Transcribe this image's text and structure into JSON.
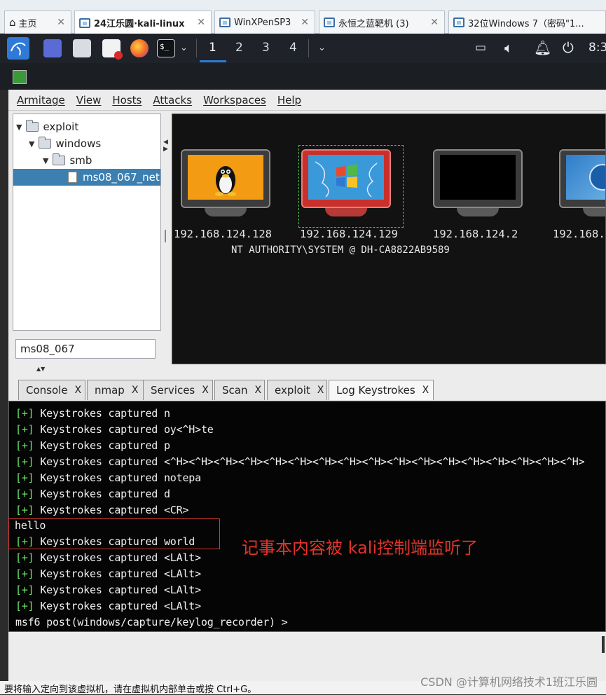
{
  "vm_tabs": [
    {
      "label": "主页",
      "active": false
    },
    {
      "label": "24江乐圆·kali-linux",
      "active": true
    },
    {
      "label": "WinXPenSP3",
      "active": false
    },
    {
      "label": "永恒之蓝靶机 (3)",
      "active": false
    },
    {
      "label": "32位Windows 7（密码\"1...",
      "active": false
    }
  ],
  "taskbar": {
    "workspaces": [
      "1",
      "2",
      "3",
      "4"
    ],
    "active_workspace": "1",
    "clock": "8:3"
  },
  "menu": [
    "Armitage",
    "View",
    "Hosts",
    "Attacks",
    "Workspaces",
    "Help"
  ],
  "tree": {
    "items": [
      {
        "label": "exploit"
      },
      {
        "label": "windows"
      },
      {
        "label": "smb"
      },
      {
        "label": "ms08_067_net"
      }
    ]
  },
  "search": {
    "value": "ms08_067"
  },
  "hosts": [
    {
      "ip": "192.168.124.128",
      "os": "linux"
    },
    {
      "ip": "192.168.124.129",
      "os": "windows-xp",
      "compromised": true,
      "user": "NT AUTHORITY\\SYSTEM @ DH-CA8822AB9589"
    },
    {
      "ip": "192.168.124.2",
      "os": "unknown"
    },
    {
      "ip": "192.168.",
      "os": "windows-7"
    }
  ],
  "console_tabs": [
    {
      "label": "Console",
      "close": "X"
    },
    {
      "label": "nmap",
      "close": "X"
    },
    {
      "label": "Services",
      "close": "X"
    },
    {
      "label": "Scan",
      "close": "X"
    },
    {
      "label": "exploit",
      "close": "X"
    },
    {
      "label": "Log Keystrokes",
      "close": "X",
      "active": true
    }
  ],
  "console_lines": [
    {
      "prefix": "[+]",
      "text": "Keystrokes captured n"
    },
    {
      "prefix": "[+]",
      "text": "Keystrokes captured oy<^H>te"
    },
    {
      "prefix": "[+]",
      "text": "Keystrokes captured p"
    },
    {
      "prefix": "[+]",
      "text": "Keystrokes captured <^H><^H><^H><^H><^H><^H><^H><^H><^H><^H><^H><^H><^H><^H><^H><^H><^H>"
    },
    {
      "prefix": "[+]",
      "text": "Keystrokes captured notepa"
    },
    {
      "prefix": "[+]",
      "text": "Keystrokes captured d"
    },
    {
      "prefix": "[+]",
      "text": "Keystrokes captured <CR>"
    },
    {
      "prefix": "",
      "text": "hello"
    },
    {
      "prefix": "[+]",
      "text": "Keystrokes captured world"
    },
    {
      "prefix": "[+]",
      "text": "Keystrokes captured <LAlt>"
    },
    {
      "prefix": "[+]",
      "text": "Keystrokes captured <LAlt>"
    },
    {
      "prefix": "[+]",
      "text": "Keystrokes captured <LAlt>"
    },
    {
      "prefix": "[+]",
      "text": "Keystrokes captured <LAlt>"
    },
    {
      "prefix": "",
      "text": "msf6 post(windows/capture/keylog_recorder) >"
    }
  ],
  "annotation": "记事本内容被 kali控制端监听了",
  "status_text": "要将输入定向到该虚拟机，请在虚拟机内部单击或按 Ctrl+G。",
  "watermark": "CSDN @计算机网络技术1班江乐圆",
  "colors": {
    "prompt_green": "#6be36b",
    "annotation_red": "#e2332a",
    "selection_blue": "#3c7fb1"
  }
}
